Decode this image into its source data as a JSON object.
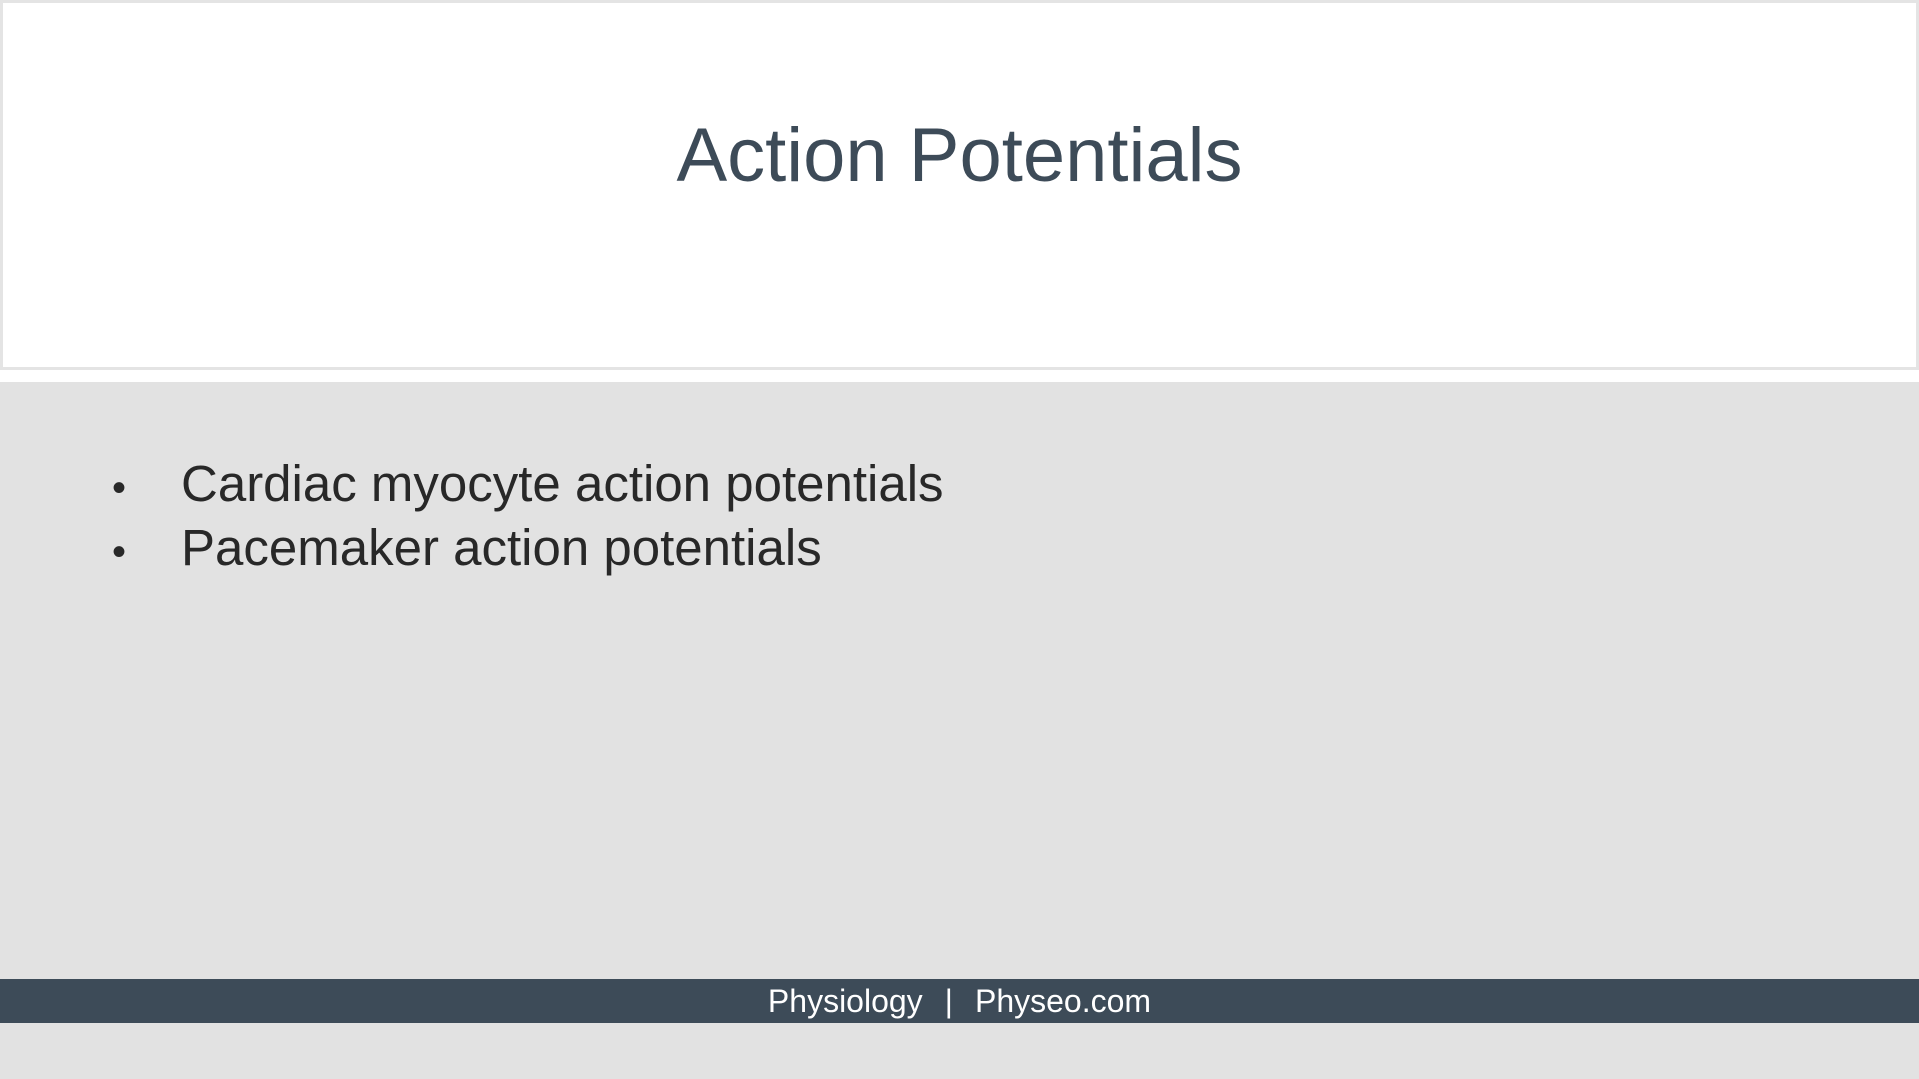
{
  "slide": {
    "title": "Action Potentials",
    "bullets": [
      "Cardiac myocyte action potentials",
      "Pacemaker action potentials"
    ],
    "bullet_marker": "•"
  },
  "footer": {
    "left": "Physiology",
    "separator": "|",
    "right": "Physeo.com"
  },
  "colors": {
    "title": "#3d4b58",
    "footer_bar": "#3d4b58",
    "content_background": "#e2e2e2",
    "title_background": "#ffffff",
    "body_text": "#282828"
  }
}
